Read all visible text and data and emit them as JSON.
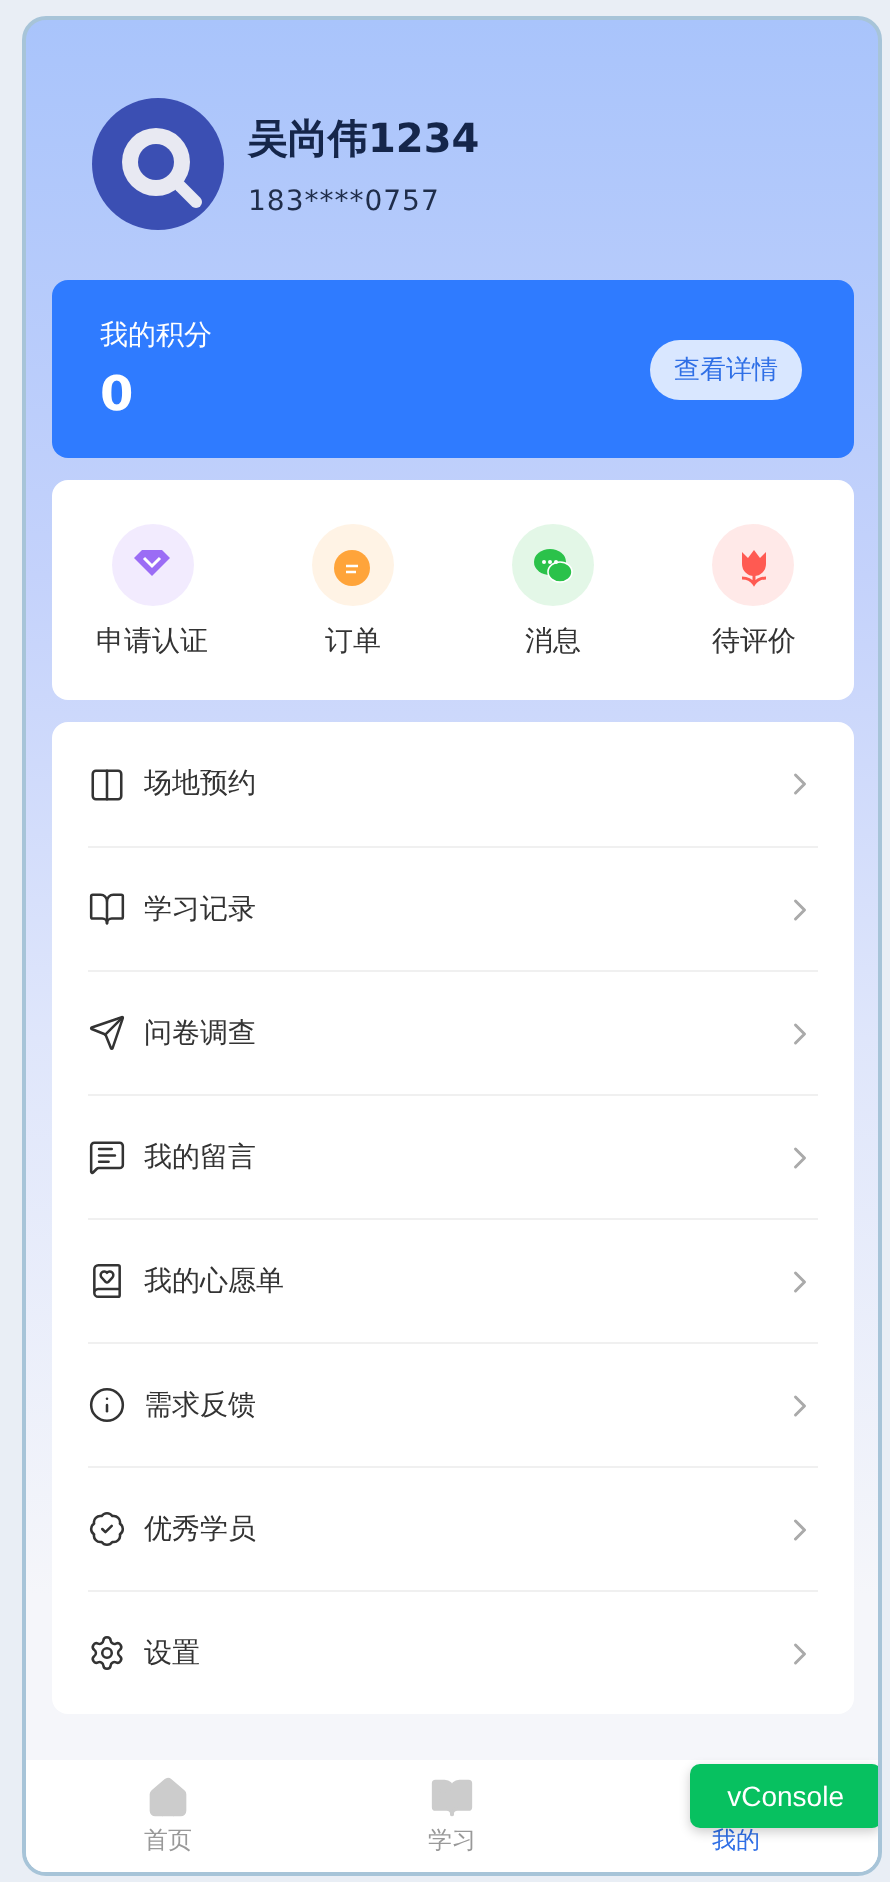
{
  "profile": {
    "name": "吴尚伟1234",
    "phone": "183****0757"
  },
  "points": {
    "label": "我的积分",
    "value": "0",
    "button": "查看详情"
  },
  "shortcuts": [
    {
      "kind": "gem",
      "label": "申请认证",
      "color": "#9b6cf5"
    },
    {
      "kind": "order",
      "label": "订单",
      "color": "#ffa43a"
    },
    {
      "kind": "chat",
      "label": "消息",
      "color": "#2bc24a"
    },
    {
      "kind": "flower",
      "label": "待评价",
      "color": "#ff5a52"
    }
  ],
  "menu": [
    {
      "kind": "venue",
      "label": "场地预约"
    },
    {
      "kind": "book",
      "label": "学习记录"
    },
    {
      "kind": "send",
      "label": "问卷调查"
    },
    {
      "kind": "message",
      "label": "我的留言"
    },
    {
      "kind": "wish",
      "label": "我的心愿单"
    },
    {
      "kind": "info",
      "label": "需求反馈"
    },
    {
      "kind": "badge",
      "label": "优秀学员"
    },
    {
      "kind": "settings",
      "label": "设置"
    }
  ],
  "tabs": [
    {
      "kind": "home",
      "label": "首页",
      "selected": false
    },
    {
      "kind": "study",
      "label": "学习",
      "selected": false
    },
    {
      "kind": "mine",
      "label": "我的",
      "selected": true
    }
  ],
  "console_button": "vConsole"
}
